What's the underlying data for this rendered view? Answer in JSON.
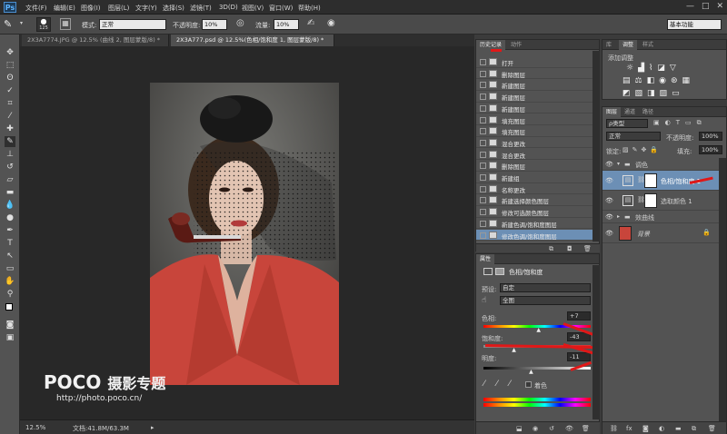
{
  "app": {
    "logo": "Ps"
  },
  "menu": [
    "文件(F)",
    "编辑(E)",
    "图像(I)",
    "图层(L)",
    "文字(Y)",
    "选择(S)",
    "滤镜(T)",
    "3D(D)",
    "视图(V)",
    "窗口(W)",
    "帮助(H)"
  ],
  "window_controls": [
    "—",
    "□",
    "✕"
  ],
  "options": {
    "brush_size": "125",
    "mode_label": "模式:",
    "mode_value": "正常",
    "opacity_label": "不透明度:",
    "opacity_value": "10%",
    "flow_label": "流量:",
    "flow_value": "10%",
    "workspace": "基本功能"
  },
  "doc_tabs": [
    {
      "label": "2X3A7774.JPG @ 12.5% (曲线 2, 图层蒙版/8) *"
    },
    {
      "label": "2X3A777.psd @ 12.5%(色相/饱和度 1, 图层蒙版/8) *"
    }
  ],
  "status": {
    "zoom": "12.5%",
    "doc": "文档:41.8M/63.3M"
  },
  "watermark": {
    "brand": "POCO",
    "slogan": "摄影专题",
    "url": "http://photo.poco.cn/"
  },
  "history": {
    "tabs": [
      "历史记录",
      "动作"
    ],
    "items": [
      "打开",
      "删除图层",
      "新建图层",
      "新建图层",
      "新建图层",
      "填充图层",
      "填充图层",
      "混合更改",
      "混合更改",
      "删除图层",
      "新建组",
      "名称更改",
      "新建选择颜色图层",
      "修改可选颜色图层",
      "新建色调/饱和度图层",
      "修改色调/饱和度图层"
    ]
  },
  "properties": {
    "tab": "属性",
    "title": "色相/饱和度",
    "preset_label": "预设:",
    "preset_value": "自定",
    "channel_value": "全图",
    "hue_label": "色相:",
    "hue_value": "+7",
    "hue_level": 0.52,
    "sat_label": "饱和度:",
    "sat_value": "-43",
    "sat_level": 0.29,
    "light_label": "明度:",
    "light_value": "-11",
    "light_level": 0.45,
    "colorize_label": "着色"
  },
  "adjustments": {
    "tabs": [
      "库",
      "调整",
      "样式"
    ],
    "title": "添加调整"
  },
  "layers": {
    "tabs": [
      "图层",
      "通道",
      "路径"
    ],
    "filter": "ρ类型",
    "blend": "正常",
    "opacity_label": "不透明度:",
    "opacity_value": "100%",
    "lock_label": "锁定:",
    "fill_label": "填充:",
    "fill_value": "100%",
    "items": [
      {
        "name": "调色",
        "kind": "group"
      },
      {
        "name": "色相/饱和度 1",
        "kind": "adjustment"
      },
      {
        "name": "选取颜色 1",
        "kind": "adjustment"
      },
      {
        "name": "效曲线",
        "kind": "group"
      },
      {
        "name": "背景",
        "kind": "image"
      }
    ]
  },
  "colors": {
    "accent": "#6c8fb5",
    "arrow": "#e01818",
    "jacket": "#c8453b"
  }
}
